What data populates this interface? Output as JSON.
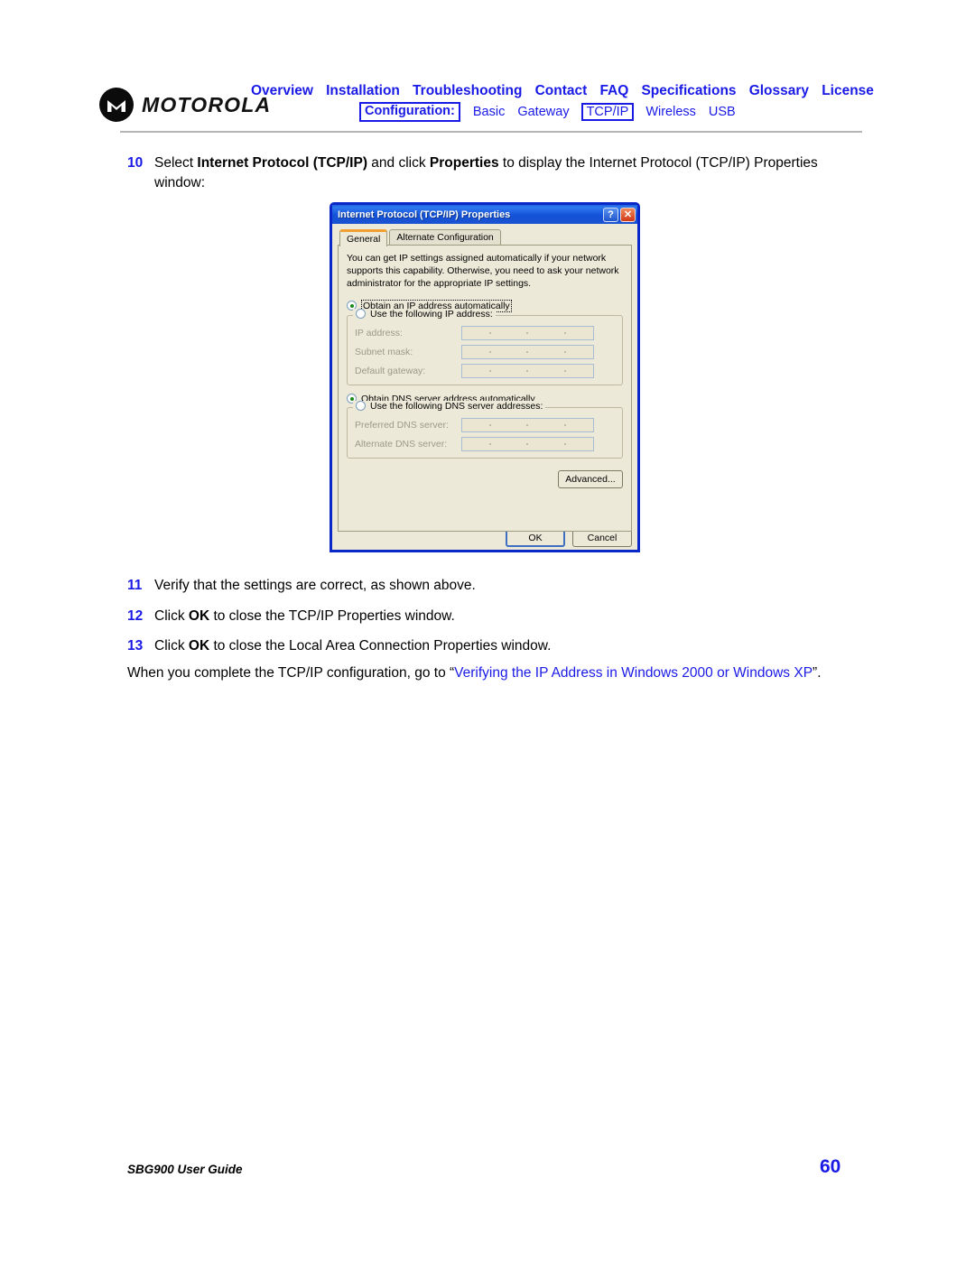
{
  "header": {
    "logo_text": "MOTOROLA",
    "nav_primary": [
      {
        "label": "Overview"
      },
      {
        "label": "Installation"
      },
      {
        "label": "Troubleshooting"
      },
      {
        "label": "Contact"
      },
      {
        "label": "FAQ"
      },
      {
        "label": "Specifications"
      },
      {
        "label": "Glossary"
      },
      {
        "label": "License"
      }
    ],
    "nav_secondary": {
      "section_label": "Configuration:",
      "items": [
        {
          "label": "Basic"
        },
        {
          "label": "Gateway"
        },
        {
          "label": "TCP/IP"
        },
        {
          "label": "Wireless"
        },
        {
          "label": "USB"
        }
      ]
    },
    "accent_color": "#1a1ae6"
  },
  "steps": {
    "s10": {
      "num": "10",
      "part1": "Select ",
      "bold1": "Internet Protocol (TCP/IP)",
      "part2": " and click ",
      "bold2": "Properties",
      "part3": " to display the Internet Protocol (TCP/IP) Properties window:"
    },
    "s11": {
      "num": "11",
      "text": "Verify that the settings are correct, as shown above."
    },
    "s12": {
      "num": "12",
      "part1": "Click ",
      "bold1": "OK",
      "part2": " to close the TCP/IP Properties window."
    },
    "s13": {
      "num": "13",
      "part1": "Click ",
      "bold1": "OK",
      "part2": " to close the Local Area Connection Properties window."
    }
  },
  "closing": {
    "part1": "When you complete the TCP/IP configuration, go to “",
    "link": "Verifying the IP Address in Windows 2000 or Windows XP",
    "part2": "”."
  },
  "dialog": {
    "title": "Internet Protocol (TCP/IP) Properties",
    "help_glyph": "?",
    "close_glyph": "✕",
    "tabs": [
      {
        "label": "General",
        "active": true
      },
      {
        "label": "Alternate Configuration",
        "active": false
      }
    ],
    "intro": "You can get IP settings assigned automatically if your network supports this capability. Otherwise, you need to ask your network administrator for the appropriate IP settings.",
    "ip_section": {
      "auto_option": "Obtain an IP address automatically",
      "manual_option": "Use the following IP address:",
      "fields": [
        {
          "label": "IP address:",
          "value": ""
        },
        {
          "label": "Subnet mask:",
          "value": ""
        },
        {
          "label": "Default gateway:",
          "value": ""
        }
      ]
    },
    "dns_section": {
      "auto_option": "Obtain DNS server address automatically",
      "manual_option": "Use the following DNS server addresses:",
      "fields": [
        {
          "label": "Preferred DNS server:",
          "value": ""
        },
        {
          "label": "Alternate DNS server:",
          "value": ""
        }
      ]
    },
    "advanced_label": "Advanced...",
    "ok_label": "OK",
    "cancel_label": "Cancel"
  },
  "footer": {
    "guide_title": "SBG900 User Guide",
    "page_number": "60"
  }
}
